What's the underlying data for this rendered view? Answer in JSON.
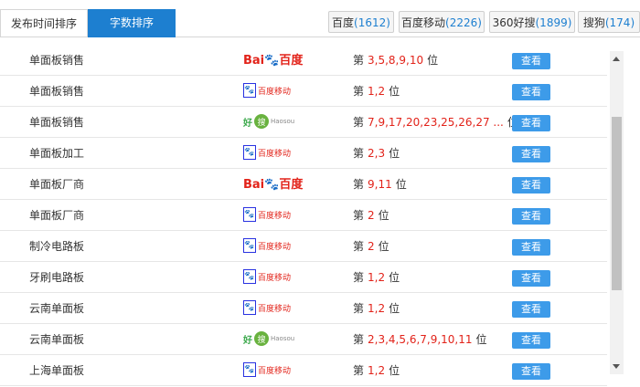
{
  "tabs": {
    "publish_time": "发布时间排序",
    "word_count": "字数排序"
  },
  "engines": [
    {
      "name": "百度",
      "count": "(1612)"
    },
    {
      "name": "百度移动",
      "count": "(2226)"
    },
    {
      "name": "360好搜",
      "count": "(1899)"
    },
    {
      "name": "搜狗",
      "count": "(174)"
    }
  ],
  "rank_prefix": "第",
  "rank_suffix": "位",
  "view_button": "查看",
  "logo_text": {
    "baidu_bai": "Bai",
    "baidu_du": "百度",
    "baidu_mobile": "百度移动",
    "haosou_hao": "好",
    "haosou_sou": "搜",
    "haosou_en": "Haosou"
  },
  "rows": [
    {
      "keyword": "单面板销售",
      "engine": "baidu",
      "positions": "3,5,8,9,10"
    },
    {
      "keyword": "单面板销售",
      "engine": "baidu-mobile",
      "positions": "1,2"
    },
    {
      "keyword": "单面板销售",
      "engine": "haosou",
      "positions": "7,9,17,20,23,25,26,27 ..."
    },
    {
      "keyword": "单面板加工",
      "engine": "baidu-mobile",
      "positions": "2,3"
    },
    {
      "keyword": "单面板厂商",
      "engine": "baidu",
      "positions": "9,11"
    },
    {
      "keyword": "单面板厂商",
      "engine": "baidu-mobile",
      "positions": "2"
    },
    {
      "keyword": "制冷电路板",
      "engine": "baidu-mobile",
      "positions": "2"
    },
    {
      "keyword": "牙刷电路板",
      "engine": "baidu-mobile",
      "positions": "1,2"
    },
    {
      "keyword": "云南单面板",
      "engine": "baidu-mobile",
      "positions": "1,2"
    },
    {
      "keyword": "云南单面板",
      "engine": "haosou",
      "positions": "2,3,4,5,6,7,9,10,11"
    },
    {
      "keyword": "上海单面板",
      "engine": "baidu-mobile",
      "positions": "1,2"
    }
  ]
}
